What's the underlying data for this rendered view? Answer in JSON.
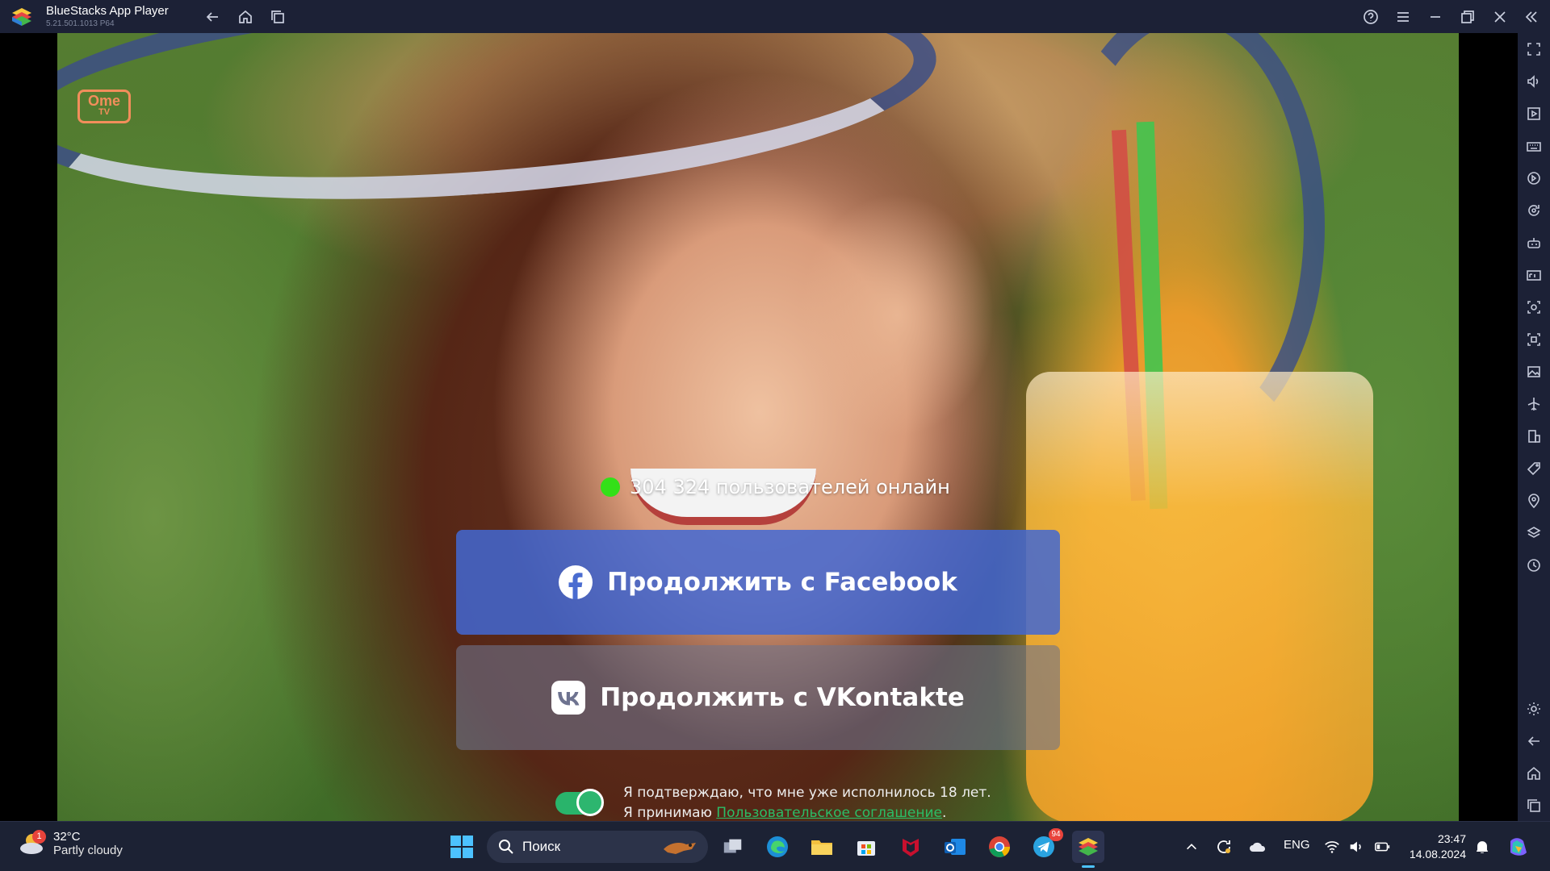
{
  "window": {
    "title": "BlueStacks App Player",
    "version": "5.21.501.1013 P64"
  },
  "app": {
    "logo_text_top": "Ome",
    "logo_text_bottom": "TV",
    "online_count_text": "304 324 пользователей онлайн",
    "facebook_button": "Продолжить с Facebook",
    "vk_button": "Продолжить с VKontakte",
    "age_confirm": "Я подтверждаю, что мне уже исполнилось 18 лет.",
    "terms_prefix": "Я принимаю ",
    "terms_link": "Пользовательское соглашение",
    "terms_suffix": ".",
    "age_toggle_on": true,
    "colors": {
      "facebook": "#4267d2",
      "online_dot": "#33e018",
      "toggle": "#2db66f"
    }
  },
  "sidebar_icons": [
    "fullscreen-icon",
    "volume-icon",
    "media-icon",
    "keyboard-icon",
    "rotate-icon",
    "sync-icon",
    "gamepad-icon",
    "fps-icon",
    "screenshot-icon",
    "record-icon",
    "gallery-icon",
    "airplane-icon",
    "multi-instance-icon",
    "macro-icon",
    "location-icon",
    "layers-icon",
    "eco-mode-icon",
    "settings-icon",
    "back-icon",
    "home-icon",
    "recents-icon"
  ],
  "taskbar": {
    "weather": {
      "temp": "32°C",
      "desc": "Partly cloudy",
      "badge": "1"
    },
    "search_placeholder": "Поиск",
    "telegram_badge": "94",
    "language": "ENG",
    "time": "23:47",
    "date": "14.08.2024"
  }
}
